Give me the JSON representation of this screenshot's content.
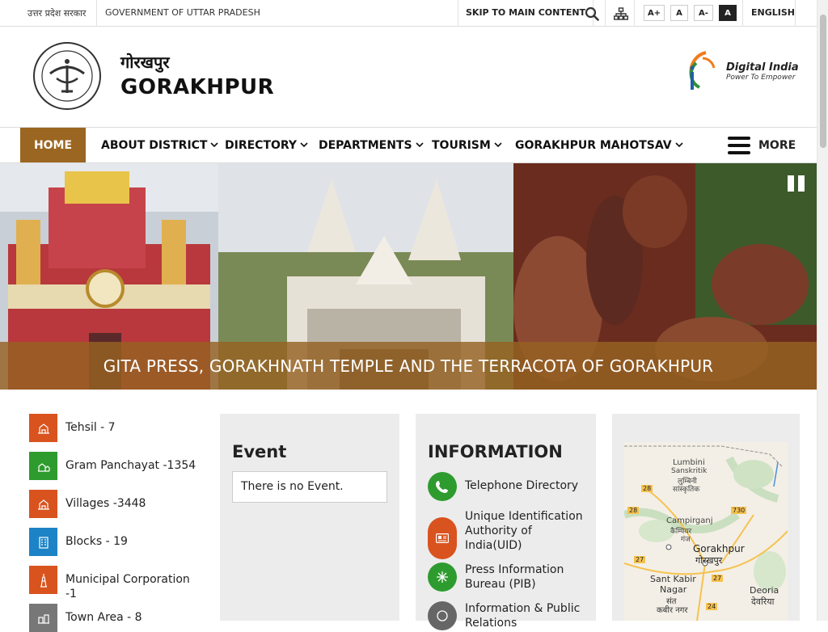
{
  "topbar": {
    "gov_hindi": "उत्तर प्रदेश सरकार",
    "gov_english": "GOVERNMENT OF UTTAR PRADESH",
    "skip": "SKIP TO MAIN CONTENT",
    "font_increase": "A+",
    "font_normal": "A",
    "font_decrease": "A-",
    "contrast": "A",
    "language": "ENGLISH"
  },
  "header": {
    "title_hindi": "गोरखपुर",
    "title_english": "GORAKHPUR",
    "digital_india_title": "Digital India",
    "digital_india_tagline": "Power To Empower"
  },
  "nav": {
    "items": [
      {
        "label": "HOME"
      },
      {
        "label": "ABOUT DISTRICT"
      },
      {
        "label": "DIRECTORY"
      },
      {
        "label": "DEPARTMENTS"
      },
      {
        "label": "TOURISM"
      },
      {
        "label": "GORAKHPUR MAHOTSAV"
      }
    ],
    "more": "MORE"
  },
  "banner": {
    "caption": "GITA PRESS, GORAKHNATH TEMPLE AND THE TERRACOTA OF GORAKHPUR"
  },
  "stats": [
    {
      "label": "Tehsil - 7",
      "color": "#d9531e",
      "icon": "building-icon"
    },
    {
      "label": "Gram Panchayat -1354",
      "color": "#2e9b2e",
      "icon": "village-icon"
    },
    {
      "label": "Villages -3448",
      "color": "#d9531e",
      "icon": "house-icon"
    },
    {
      "label": "Blocks - 19",
      "color": "#1c83c6",
      "icon": "blocks-icon"
    },
    {
      "label": "Municipal Corporation -1",
      "color": "#d9531e",
      "icon": "tower-icon"
    },
    {
      "label": "Town Area - 8",
      "color": "#777777",
      "icon": "town-icon"
    }
  ],
  "event": {
    "title": "Event",
    "empty": "There is no Event."
  },
  "information": {
    "title": "INFORMATION",
    "items": [
      {
        "label": "Telephone Directory",
        "color": "#2e9b2e",
        "icon": "phone-icon"
      },
      {
        "label": "Unique Identification Authority of India(UID)",
        "color": "#d9531e",
        "icon": "id-card-icon"
      },
      {
        "label": "Press Information Bureau (PIB)",
        "color": "#2e9b2e",
        "icon": "snowflake-icon"
      },
      {
        "label": "Information & Public Relations",
        "color": "#666666",
        "icon": "info-icon"
      }
    ]
  },
  "map": {
    "labels": [
      {
        "text": "Lumbini"
      },
      {
        "text": "Sanskritik"
      },
      {
        "text": "लुम्बिनी"
      },
      {
        "text": "सांस्कृतिक"
      },
      {
        "text": "Campirganj"
      },
      {
        "text": "कैम्पियर"
      },
      {
        "text": "गंज"
      },
      {
        "text": "Gorakhpur"
      },
      {
        "text": "गोरखपुर"
      },
      {
        "text": "Sant Kabir"
      },
      {
        "text": "Nagar"
      },
      {
        "text": "संत"
      },
      {
        "text": "कबीर नगर"
      },
      {
        "text": "Deoria"
      },
      {
        "text": "देवरिया"
      }
    ],
    "road_shields": [
      "28",
      "28",
      "730",
      "27",
      "27",
      "24"
    ]
  },
  "colors": {
    "accent_brown": "#9b6621",
    "orange": "#d9531e",
    "green": "#2e9b2e",
    "blue": "#1c83c6"
  }
}
